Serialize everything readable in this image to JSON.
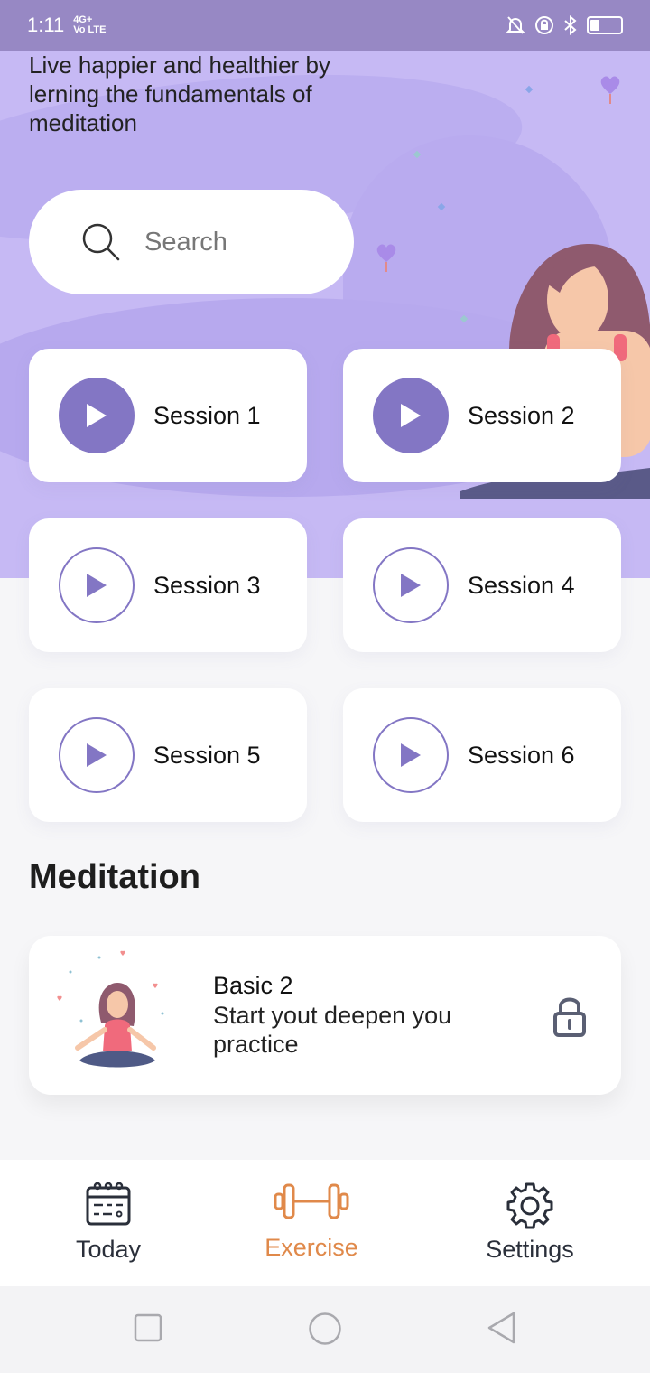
{
  "status_bar": {
    "time": "1:11",
    "network_top": "4G+",
    "network_bottom": "Vo LTE"
  },
  "header": {
    "tagline": "Live happier and healthier by lerning the fundamentals of meditation"
  },
  "search": {
    "placeholder": "Search",
    "icon": "search-icon"
  },
  "sessions": [
    {
      "label": "Session 1",
      "style": "filled"
    },
    {
      "label": "Session 2",
      "style": "filled"
    },
    {
      "label": "Session 3",
      "style": "outline"
    },
    {
      "label": "Session 4",
      "style": "outline"
    },
    {
      "label": "Session 5",
      "style": "outline"
    },
    {
      "label": "Session 6",
      "style": "outline"
    }
  ],
  "meditation": {
    "section_title": "Meditation",
    "card": {
      "title": "Basic 2",
      "description": "Start yout deepen you practice",
      "locked": true
    }
  },
  "tabs": [
    {
      "label": "Today",
      "icon": "calendar-icon",
      "active": false
    },
    {
      "label": "Exercise",
      "icon": "dumbbell-icon",
      "active": true
    },
    {
      "label": "Settings",
      "icon": "gear-icon",
      "active": false
    }
  ],
  "colors": {
    "accent": "#8376c4",
    "hero_background": "#c6b9f4",
    "active_tab": "#e0894a",
    "status_bar": "#9788c4"
  }
}
